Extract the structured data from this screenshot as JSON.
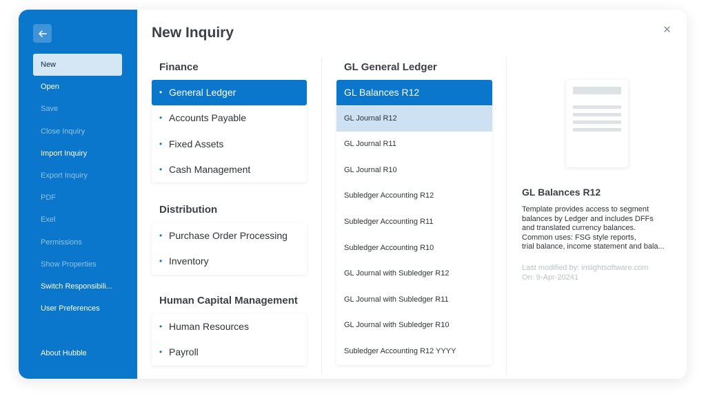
{
  "window": {
    "title": "New Inquiry"
  },
  "sidebar": {
    "items": [
      {
        "label": "New",
        "state": "active"
      },
      {
        "label": "Open",
        "state": "enabled"
      },
      {
        "label": "Save",
        "state": "disabled"
      },
      {
        "label": "Close Inquiry",
        "state": "disabled"
      },
      {
        "label": "Import Inquiry",
        "state": "enabled"
      },
      {
        "label": "Export Inquiry",
        "state": "disabled"
      },
      {
        "label": "PDF",
        "state": "disabled"
      },
      {
        "label": "Exel",
        "state": "disabled"
      },
      {
        "label": "Permissions",
        "state": "disabled"
      },
      {
        "label": "Show Properties",
        "state": "disabled"
      },
      {
        "label": "Switch Responsibili...",
        "state": "enabled"
      },
      {
        "label": "User Preferences",
        "state": "enabled"
      }
    ],
    "footer_label": "About Hubble"
  },
  "categories": [
    {
      "heading": "Finance",
      "items": [
        "General Ledger",
        "Accounts Payable",
        "Fixed Assets",
        "Cash Management"
      ]
    },
    {
      "heading": "Distribution",
      "items": [
        "Purchase Order Processing",
        "Inventory"
      ]
    },
    {
      "heading": "Human Capital Management",
      "items": [
        "Human Resources",
        "Payroll"
      ]
    }
  ],
  "selected_category": "General Ledger",
  "bullet_char": "•",
  "templates_panel": {
    "heading": "GL General Ledger",
    "items": [
      "GL Balances R12",
      "GL Journal R12",
      "GL Journal R11",
      "GL Journal R10",
      "Subledger Accounting R12",
      "Subledger Accounting R11",
      "Subledger Accounting R10",
      "GL Journal with Subledger R12",
      "GL Journal with Subledger R11",
      "GL Journal with Subledger R10",
      "Subledger Accounting R12 YYYY"
    ],
    "selected": "GL Balances R12",
    "hovered": "GL Journal R12"
  },
  "details": {
    "title": "GL Balances R12",
    "description_lines": [
      "Template provides access to segment",
      "balances by Ledger and includes DFFs",
      "and translated currency balances.",
      "Common uses: FSG style reports,",
      "trial balance, income statement and bala..."
    ],
    "modified_by": "Last modified by: insightsoftware.com",
    "modified_on": "On: 9-Apr-20241"
  },
  "icons": {
    "back": "back-arrow-icon",
    "close": "close-icon",
    "preview": "document-thumbnail-icon"
  },
  "colors": {
    "accent": "#0a77cc",
    "sidebar_active_bg": "#d5e6f4",
    "hover_row_bg": "#cde1f2",
    "text_dark": "#2c3338",
    "muted": "#b9c2ca"
  }
}
